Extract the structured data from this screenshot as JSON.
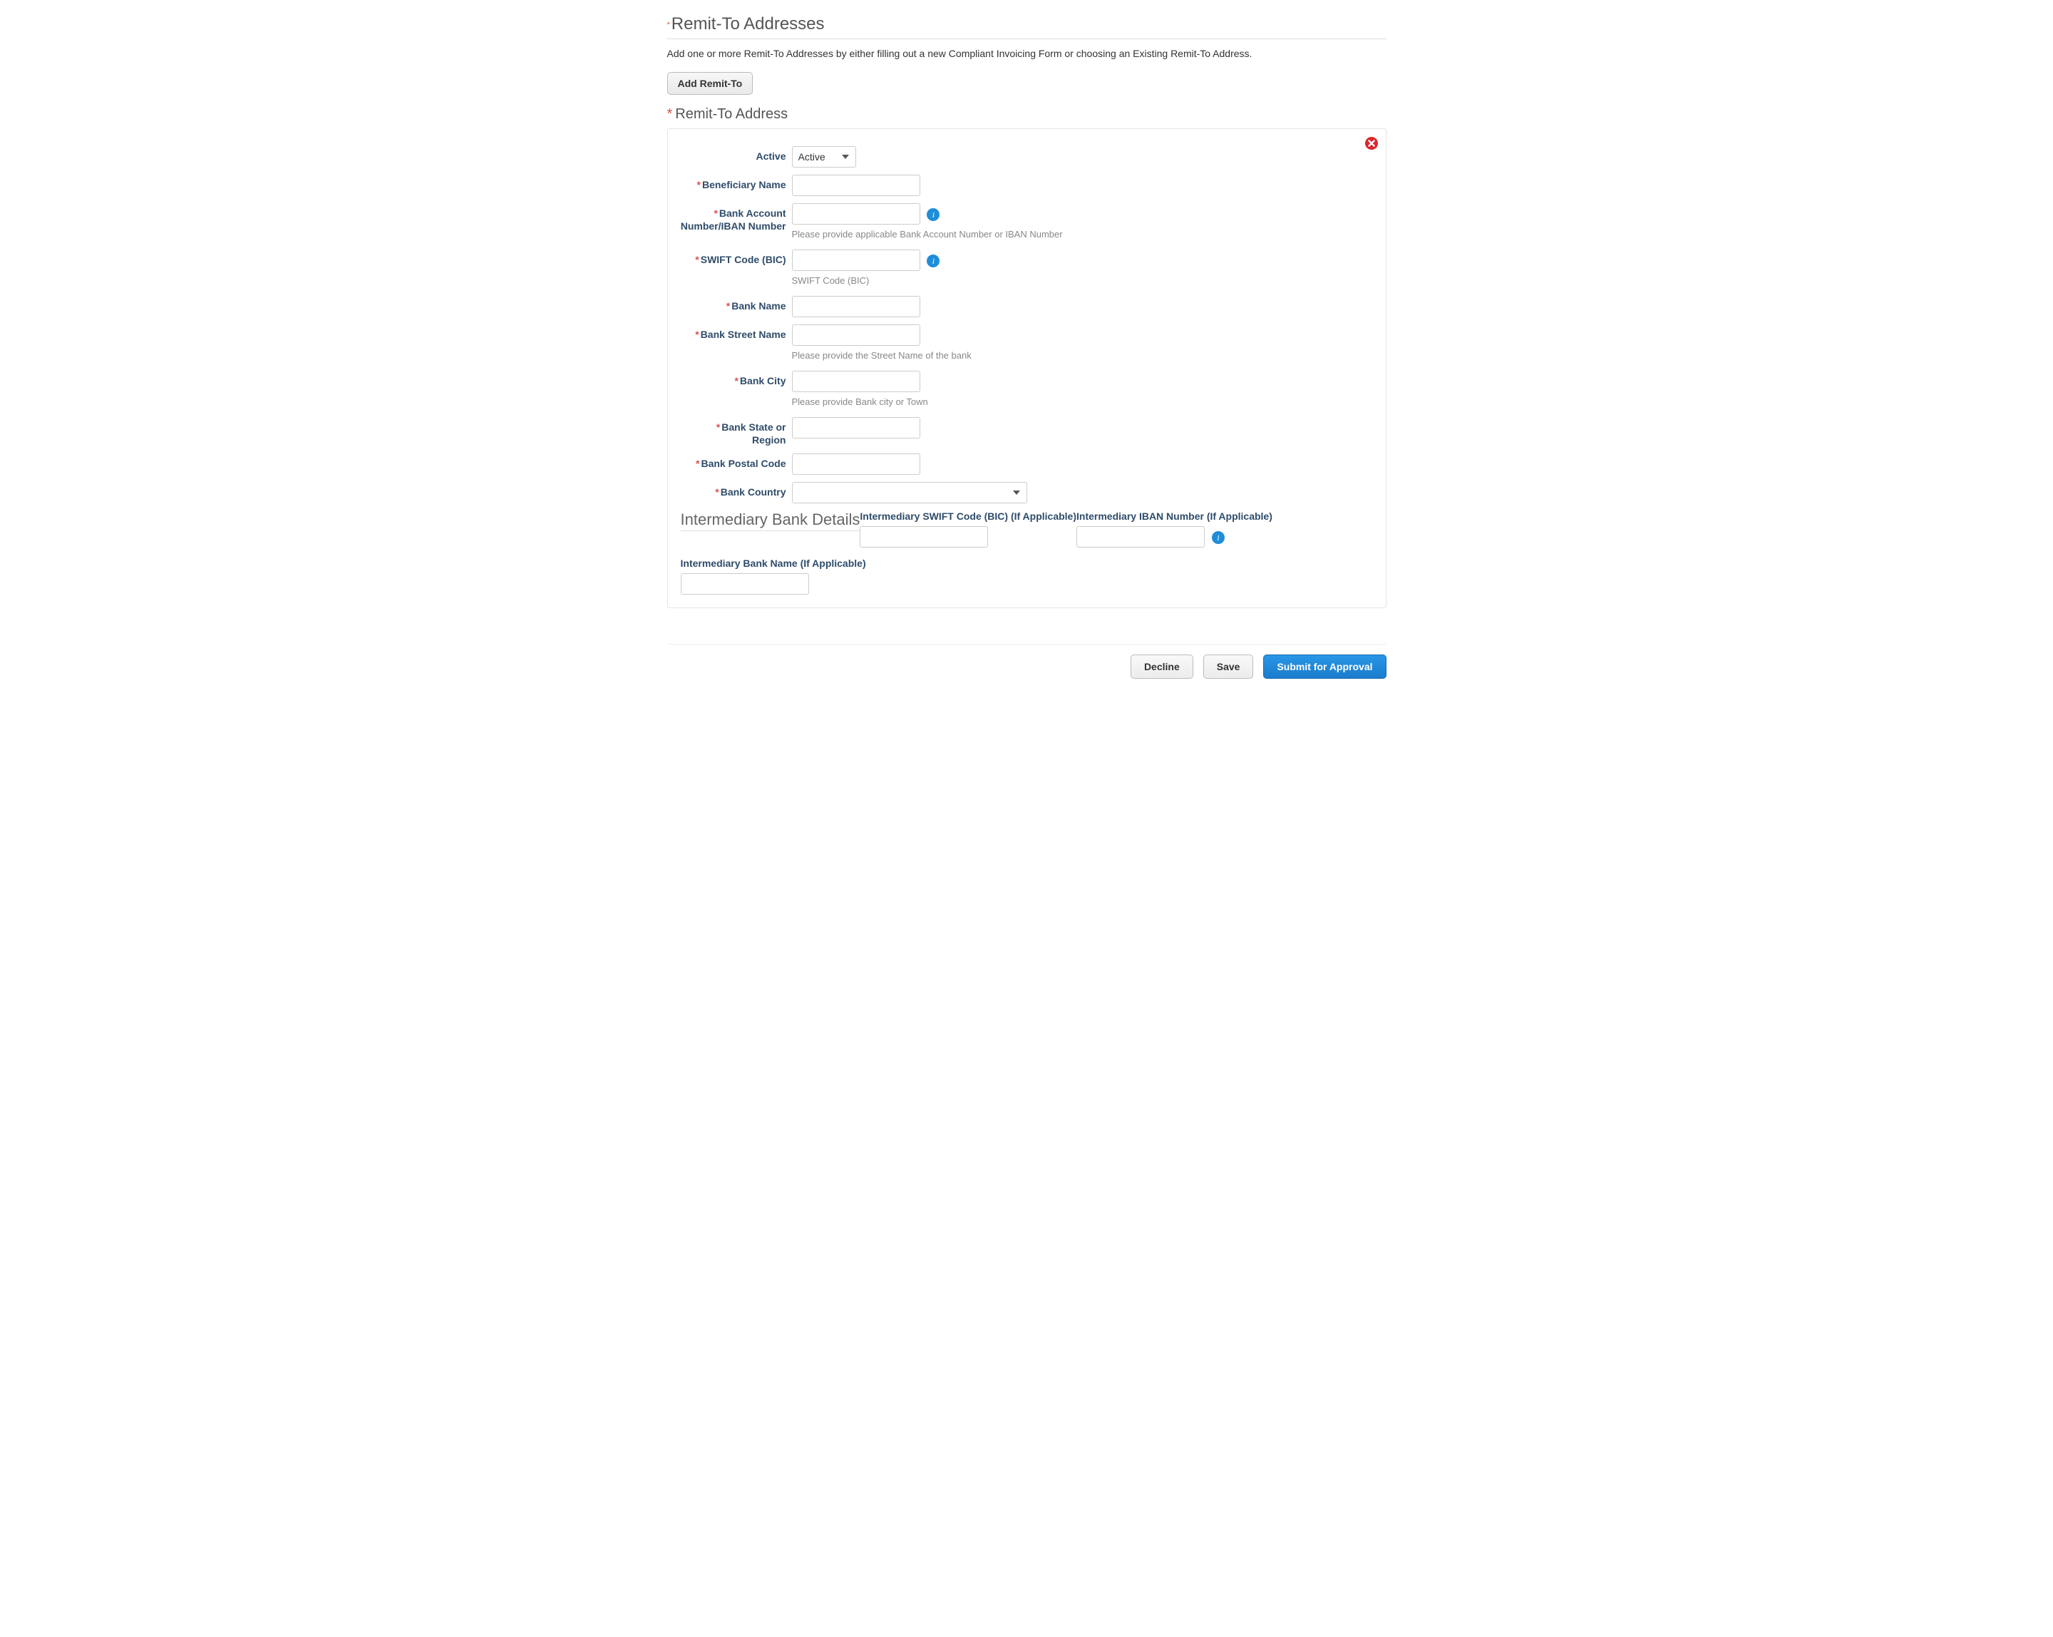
{
  "section": {
    "title": "Remit-To Addresses",
    "intro": "Add one or more Remit-To Addresses by either filling out a new Compliant Invoicing Form or choosing an Existing Remit-To Address.",
    "add_button": "Add Remit-To",
    "sub_title": "Remit-To Address"
  },
  "form": {
    "labels": {
      "active": "Active",
      "beneficiary_name": "Beneficiary Name",
      "bank_account": "Bank Account Number/IBAN Number",
      "swift": "SWIFT Code (BIC)",
      "bank_name": "Bank Name",
      "bank_street": "Bank Street Name",
      "bank_city": "Bank City",
      "bank_state": "Bank State or Region",
      "bank_postal": "Bank Postal Code",
      "bank_country": "Bank Country"
    },
    "hints": {
      "bank_account": "Please provide applicable Bank Account Number or IBAN Number",
      "swift": "SWIFT Code (BIC)",
      "bank_street": "Please provide the Street Name of the bank",
      "bank_city": "Please provide Bank city or Town"
    },
    "values": {
      "active_selected": "Active",
      "beneficiary_name": "",
      "bank_account": "",
      "swift": "",
      "bank_name": "",
      "bank_street": "",
      "bank_city": "",
      "bank_state": "",
      "bank_postal": "",
      "bank_country": ""
    },
    "info_icon_glyph": "i"
  },
  "intermediary": {
    "title": "Intermediary Bank Details",
    "labels": {
      "swift": "Intermediary SWIFT Code (BIC) (If Applicable)",
      "iban": "Intermediary IBAN Number (If Applicable)",
      "bank_name": "Intermediary Bank Name (If Applicable)"
    },
    "values": {
      "swift": "",
      "iban": "",
      "bank_name": ""
    }
  },
  "actions": {
    "decline": "Decline",
    "save": "Save",
    "submit": "Submit for Approval"
  }
}
